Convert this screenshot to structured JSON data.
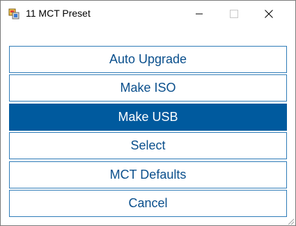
{
  "window": {
    "title": "11 MCT Preset",
    "icon": "app-icon"
  },
  "controls": {
    "minimize_icon": "minimize-icon",
    "maximize_icon": "maximize-icon",
    "close_icon": "close-icon"
  },
  "buttons": [
    {
      "label": "Auto Upgrade",
      "selected": false
    },
    {
      "label": "Make ISO",
      "selected": false
    },
    {
      "label": "Make USB",
      "selected": true
    },
    {
      "label": "Select",
      "selected": false
    },
    {
      "label": "MCT Defaults",
      "selected": false
    },
    {
      "label": "Cancel",
      "selected": false
    }
  ],
  "colors": {
    "accent": "#005a9e",
    "button_border": "#2f7cb8",
    "button_text": "#0a4f8c"
  }
}
